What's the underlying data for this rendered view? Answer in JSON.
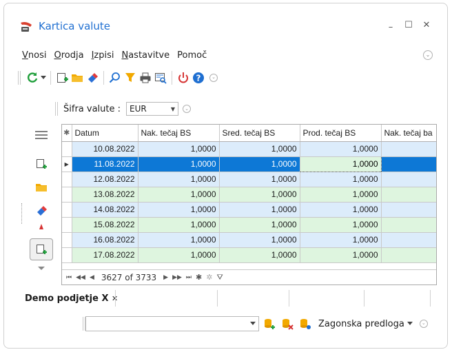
{
  "window": {
    "title": "Kartica valute",
    "minimize": "–",
    "maximize": "☐",
    "close": "✕"
  },
  "menu": [
    {
      "label": "Vnosi",
      "ul": "V",
      "rest": "nosi"
    },
    {
      "label": "Orodja",
      "ul": "O",
      "rest": "rodja"
    },
    {
      "label": "Izpisi",
      "ul": "I",
      "rest": "zpisi"
    },
    {
      "label": "Nastavitve",
      "ul": "N",
      "rest": "astavitve"
    },
    {
      "label": "Pomoč",
      "ul": "",
      "rest": "Pomoč"
    }
  ],
  "filter": {
    "label": "Šifra valute :",
    "value": "EUR"
  },
  "grid": {
    "columns": [
      "Datum",
      "Nak. tečaj BS",
      "Sred. tečaj BS",
      "Prod. tečaj BS",
      "Nak. tečaj ba"
    ],
    "rows": [
      {
        "date": "10.08.2022",
        "nak": "1,0000",
        "sred": "1,0000",
        "prod": "1,0000",
        "style": "blue"
      },
      {
        "date": "11.08.2022",
        "nak": "1,0000",
        "sred": "1,0000",
        "prod": "1,0000",
        "style": "selected"
      },
      {
        "date": "12.08.2022",
        "nak": "1,0000",
        "sred": "1,0000",
        "prod": "1,0000",
        "style": "blue"
      },
      {
        "date": "13.08.2022",
        "nak": "1,0000",
        "sred": "1,0000",
        "prod": "1,0000",
        "style": "green"
      },
      {
        "date": "14.08.2022",
        "nak": "1,0000",
        "sred": "1,0000",
        "prod": "1,0000",
        "style": "blue"
      },
      {
        "date": "15.08.2022",
        "nak": "1,0000",
        "sred": "1,0000",
        "prod": "1,0000",
        "style": "green"
      },
      {
        "date": "16.08.2022",
        "nak": "1,0000",
        "sred": "1,0000",
        "prod": "1,0000",
        "style": "blue"
      },
      {
        "date": "17.08.2022",
        "nak": "1,0000",
        "sred": "1,0000",
        "prod": "1,0000",
        "style": "green"
      }
    ],
    "navigator_text": "3627 of 3733"
  },
  "tabs": {
    "active": "Demo podjetje X"
  },
  "bottom": {
    "template_label": "Zagonska predloga"
  },
  "colors": {
    "title": "#1f6fd1",
    "selected_row": "#0d78d6",
    "row_blue": "#dcecfb",
    "row_green": "#def5df"
  }
}
